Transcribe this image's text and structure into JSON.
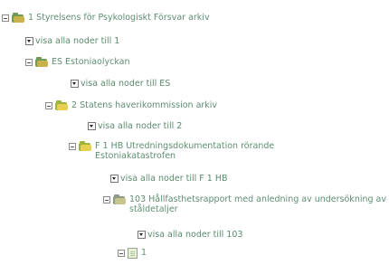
{
  "tree": {
    "n1": {
      "label": "1 Styrelsens för Psykologiskt Försvar arkiv"
    },
    "l1": {
      "label": "visa alla noder till 1"
    },
    "n2": {
      "label": "ES Estoniaolyckan"
    },
    "l2": {
      "label": "visa alla noder till ES"
    },
    "n3": {
      "label": "2 Statens haverikommission arkiv"
    },
    "l3": {
      "label": "visa alla noder till 2"
    },
    "n4": {
      "label": "F 1 HB Utredningsdokumentation rörande Estoniakatastrofen"
    },
    "l4": {
      "label": "visa alla noder till F 1 HB"
    },
    "n5": {
      "label": "103 Hållfasthetsrapport med anledning av undersökning av ståldetaljer"
    },
    "l5": {
      "label": "visa alla noder till 103"
    },
    "n6": {
      "label": "1"
    }
  },
  "colors": {
    "link_text": "#5b8a6b",
    "folder_green": "#6f9a58",
    "folder_yellow": "#e6d052"
  }
}
